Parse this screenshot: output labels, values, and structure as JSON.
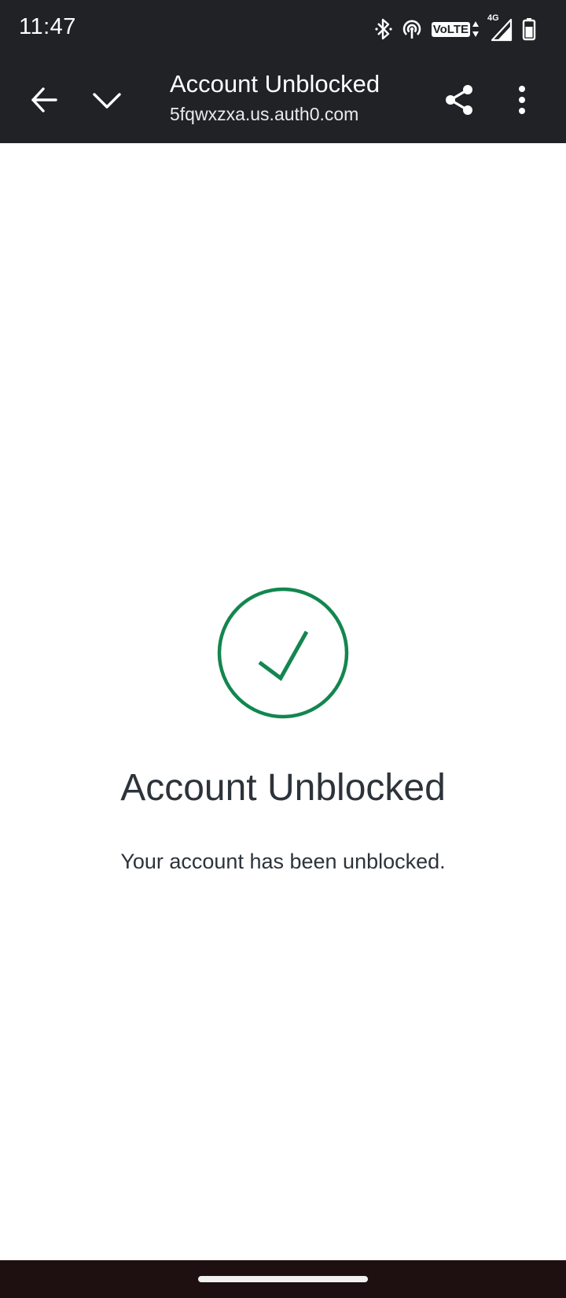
{
  "status_bar": {
    "time": "11:47",
    "volte_label": "VoLTE",
    "network_label": "4G",
    "icons": [
      "bluetooth-icon",
      "hotspot-icon",
      "volte-icon",
      "signal-icon",
      "battery-icon"
    ]
  },
  "toolbar": {
    "title": "Account Unblocked",
    "url": "5fqwxzxa.us.auth0.com",
    "icons": [
      "back-arrow-icon",
      "chevron-down-icon",
      "share-icon",
      "more-vert-icon"
    ]
  },
  "content": {
    "title": "Account Unblocked",
    "description": "Your account has been unblocked.",
    "icon": "check-circle-icon"
  },
  "colors": {
    "bar_background": "#212226",
    "success_green": "#13864F",
    "text_dark": "#2d333a",
    "nav_background": "#1e1010"
  }
}
